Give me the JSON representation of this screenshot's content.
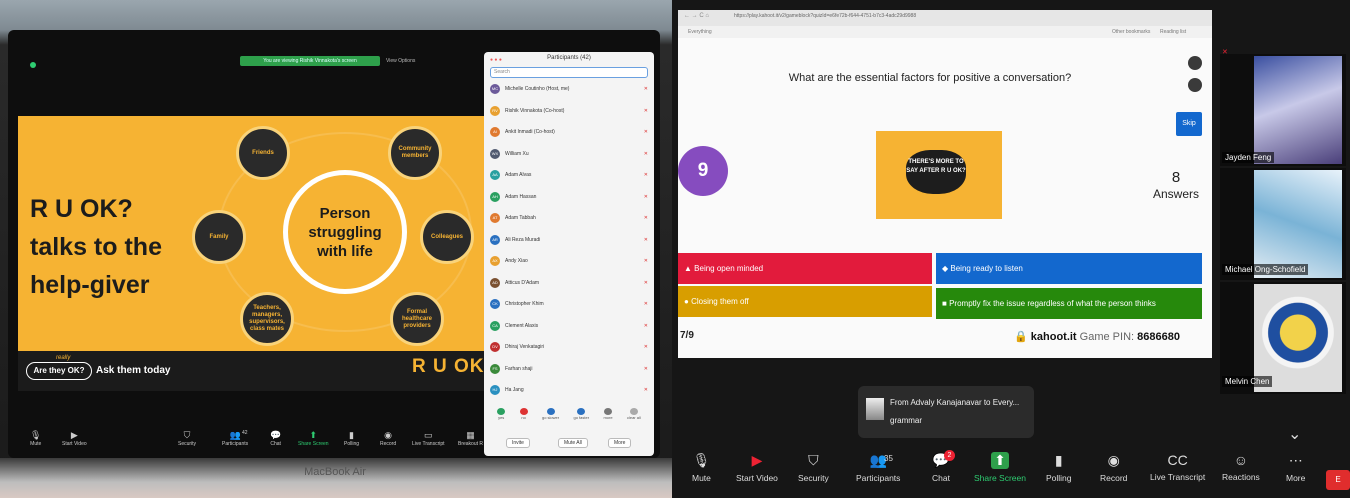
{
  "left_screen": {
    "share_banner": "You are viewing Rishik Vinnakota's screen",
    "view_options": "View Options",
    "laptop_label": "MacBook Air",
    "slide": {
      "title_lines": [
        "R U OK?",
        "talks to the",
        "help-giver"
      ],
      "center": [
        "Person",
        "struggling",
        "with life"
      ],
      "nodes": {
        "friends": "Friends",
        "community": "Community members",
        "family": "Family",
        "colleagues": "Colleagues",
        "teachers": "Teachers, managers, supervisors, class mates",
        "formal": "Formal healthcare providers"
      },
      "bottom_badge": "Are they OK?",
      "bottom_badge_tag": "really",
      "bottom_cta": "Ask them today",
      "logo": "R U OK?"
    },
    "participants": {
      "title": "Participants (42)",
      "search_placeholder": "Search",
      "rows": [
        {
          "name": "Michelle Coutinho (Host, me)",
          "initials": "MC",
          "color": "#6c5a9a"
        },
        {
          "name": "Rishik Vinnakota (Co-host)",
          "initials": "RV",
          "color": "#e8a030"
        },
        {
          "name": "Ankit Inmadi (Co-host)",
          "initials": "AI",
          "color": "#e07a30"
        },
        {
          "name": "William Xu",
          "initials": "WX",
          "color": "#505a70"
        },
        {
          "name": "Adam Alvas",
          "initials": "AA",
          "color": "#2aa0a0"
        },
        {
          "name": "Adam Hassan",
          "initials": "AH",
          "color": "#2aa060"
        },
        {
          "name": "Adam Tabbah",
          "initials": "AT",
          "color": "#e07a30"
        },
        {
          "name": "Ali Reza Muradi",
          "initials": "AR",
          "color": "#2a70c0"
        },
        {
          "name": "Andy Xiao",
          "initials": "AX",
          "color": "#e8a030"
        },
        {
          "name": "Atticus D'Adam",
          "initials": "AD",
          "color": "#7a5030"
        },
        {
          "name": "Christopher Khim",
          "initials": "CK",
          "color": "#2a70c0"
        },
        {
          "name": "Clement Alaxis",
          "initials": "CA",
          "color": "#2aa060"
        },
        {
          "name": "Dhiraj Venkatagiri",
          "initials": "DV",
          "color": "#c03030"
        },
        {
          "name": "Farhan shaji",
          "initials": "FS",
          "color": "#3a8a3a"
        },
        {
          "name": "Ha Jang",
          "initials": "HJ",
          "color": "#2a90c0"
        }
      ],
      "reactions": [
        "yes",
        "no",
        "go slower",
        "go faster",
        "more",
        "clear all"
      ],
      "invite": "Invite",
      "mute_all": "Mute All",
      "more": "More"
    },
    "toolbar": [
      {
        "label": "Mute",
        "icon": "microphone-icon"
      },
      {
        "label": "Start Video",
        "icon": "video-camera-icon"
      },
      {
        "label": "Security",
        "icon": "shield-icon"
      },
      {
        "label": "Participants",
        "icon": "participants-icon",
        "count": "42"
      },
      {
        "label": "Chat",
        "icon": "chat-icon"
      },
      {
        "label": "Share Screen",
        "icon": "share-screen-icon"
      },
      {
        "label": "Polling",
        "icon": "polling-icon"
      },
      {
        "label": "Record",
        "icon": "record-icon"
      },
      {
        "label": "Live Transcript",
        "icon": "cc-icon"
      },
      {
        "label": "Breakout R",
        "icon": "breakout-icon"
      }
    ]
  },
  "right_screen": {
    "browser_url": "https://play.kahoot.it/v2/gameblock?quizId=e6fe72b-f644-4751-b7c3-4adc29d9988",
    "bookmark_everything": "Everything",
    "bookmark_other": "Other bookmarks",
    "bookmark_reading": "Reading list",
    "kahoot": {
      "question": "What are the essential factors for positive a conversation?",
      "timer": "9",
      "skip": "Skip",
      "answers_count": "8",
      "answers_label": "Answers",
      "image_text": "THERE'S MORE TO SAY AFTER R U OK?",
      "answers": [
        {
          "text": "Being open minded",
          "shape": "▲",
          "color": "#e21b3c"
        },
        {
          "text": "Being ready to listen",
          "shape": "◆",
          "color": "#1368ce"
        },
        {
          "text": "Closing them off",
          "shape": "●",
          "color": "#d89e00"
        },
        {
          "text": "Promptly fix the issue regardless of what the person thinks",
          "shape": "■",
          "color": "#26890c"
        }
      ],
      "question_num": "7/9",
      "site": "kahoot.it",
      "pin_label": "Game PIN:",
      "pin": "8686680"
    },
    "gallery": [
      {
        "name": "Jayden Feng"
      },
      {
        "name": "Michael Ong-Schofield"
      },
      {
        "name": "Melvin Chen"
      }
    ],
    "chat_popup": {
      "from": "From Advaly Kanajanavar to Every...",
      "message": "grammar"
    },
    "toolbar": [
      {
        "label": "Mute",
        "icon": "microphone-icon"
      },
      {
        "label": "Start Video",
        "icon": "video-camera-off-icon"
      },
      {
        "label": "Security",
        "icon": "shield-icon"
      },
      {
        "label": "Participants",
        "icon": "participants-icon",
        "count": "35"
      },
      {
        "label": "Chat",
        "icon": "chat-icon",
        "badge": "2"
      },
      {
        "label": "Share Screen",
        "icon": "share-screen-icon"
      },
      {
        "label": "Polling",
        "icon": "polling-icon"
      },
      {
        "label": "Record",
        "icon": "record-icon"
      },
      {
        "label": "Live Transcript",
        "icon": "cc-icon"
      },
      {
        "label": "Reactions",
        "icon": "reactions-icon"
      },
      {
        "label": "More",
        "icon": "more-icon"
      }
    ],
    "end_label": "E"
  }
}
